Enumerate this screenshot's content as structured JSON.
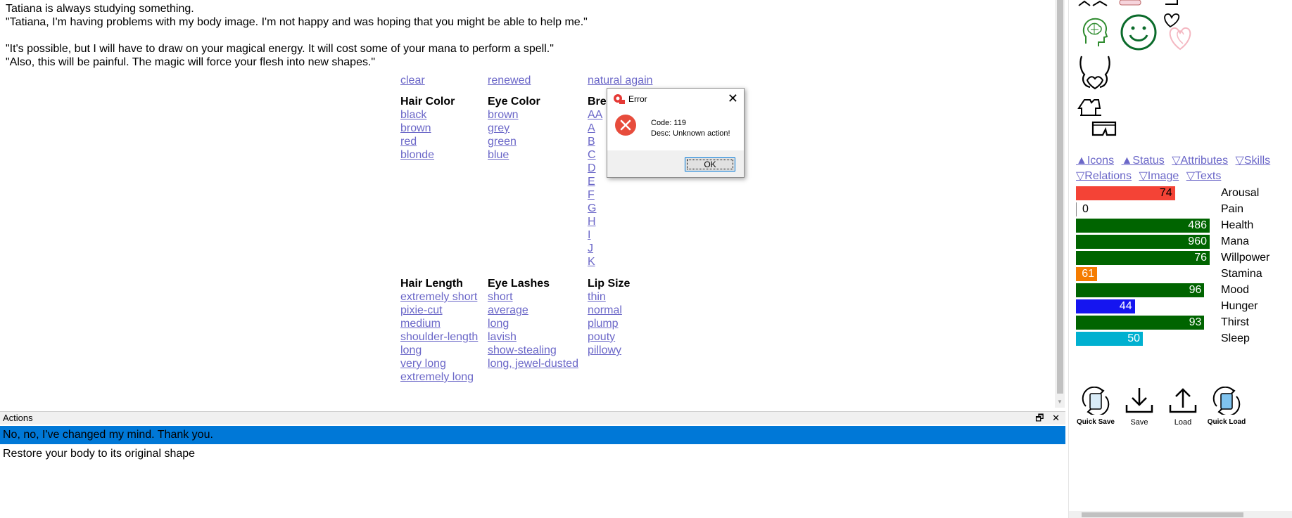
{
  "story": {
    "line1": "Tatiana is always studying something.",
    "line2": "\"Tatiana, I'm having problems with my body image. I'm not happy and was hoping that you might be able to help me.\"",
    "line3": "\"It's possible, but I will have to draw on your magical energy. It will cost some of your mana to perform a spell.\"",
    "line4": "\"Also, this will be painful. The magic will force your flesh into new shapes.\""
  },
  "top_links": [
    "clear",
    "renewed",
    "natural again"
  ],
  "hair_color": {
    "heading": "Hair Color",
    "options": [
      "black",
      "brown",
      "red",
      "blonde"
    ]
  },
  "eye_color": {
    "heading": "Eye Color",
    "options": [
      "brown",
      "grey",
      "green",
      "blue"
    ]
  },
  "breast": {
    "heading": "Bre",
    "options": [
      "AA",
      "A",
      "B",
      "C",
      "D",
      "E",
      "F",
      "G",
      "H",
      "I",
      "J",
      "K"
    ]
  },
  "hair_length": {
    "heading": "Hair Length",
    "options": [
      "extremely short",
      "pixie-cut",
      "medium",
      "shoulder-length",
      "long",
      "very long",
      "extremely long"
    ]
  },
  "eye_lashes": {
    "heading": "Eye Lashes",
    "options": [
      "short",
      "average",
      "long",
      "lavish",
      "show-stealing",
      "long, jewel-dusted"
    ]
  },
  "lip_size": {
    "heading": "Lip Size",
    "options": [
      "thin",
      "normal",
      "plump",
      "pouty",
      "pillowy"
    ]
  },
  "actions": {
    "title": "Actions",
    "items": [
      "No, no, I've changed my mind. Thank you.",
      "Restore your body to its original shape"
    ]
  },
  "dialog": {
    "title": "Error",
    "code": "Code: 119",
    "desc": "Desc: Unknown action!",
    "ok": "OK"
  },
  "tabs": {
    "row1": [
      "▲Icons",
      "▲Status",
      "▽Attributes",
      "▽Skills"
    ],
    "row2": [
      "▽Relations",
      "▽Image",
      "▽Texts"
    ]
  },
  "stats": [
    {
      "name": "Arousal",
      "value": 74,
      "fill": 0.74,
      "color": "#f44336"
    },
    {
      "name": "Pain",
      "value": 0,
      "fill": 0.0,
      "color": "#ffffff"
    },
    {
      "name": "Health",
      "value": 486,
      "fill": 1.0,
      "color": "#006400"
    },
    {
      "name": "Mana",
      "value": 960,
      "fill": 1.0,
      "color": "#006400"
    },
    {
      "name": "Willpower",
      "value": 76,
      "fill": 1.0,
      "color": "#006400"
    },
    {
      "name": "Stamina",
      "value": 61,
      "fill": 0.15,
      "color": "#f57c00"
    },
    {
      "name": "Mood",
      "value": 96,
      "fill": 0.96,
      "color": "#006400"
    },
    {
      "name": "Hunger",
      "value": 44,
      "fill": 0.44,
      "color": "#1515f0"
    },
    {
      "name": "Thirst",
      "value": 93,
      "fill": 0.96,
      "color": "#006400"
    },
    {
      "name": "Sleep",
      "value": 50,
      "fill": 0.5,
      "color": "#00b0d0"
    }
  ],
  "bottom_buttons": [
    "Quick Save",
    "Save",
    "Load",
    "Quick Load"
  ],
  "colors": {
    "link": "#6b67c8",
    "selection": "#0078d7",
    "error": "#e74c3c"
  }
}
